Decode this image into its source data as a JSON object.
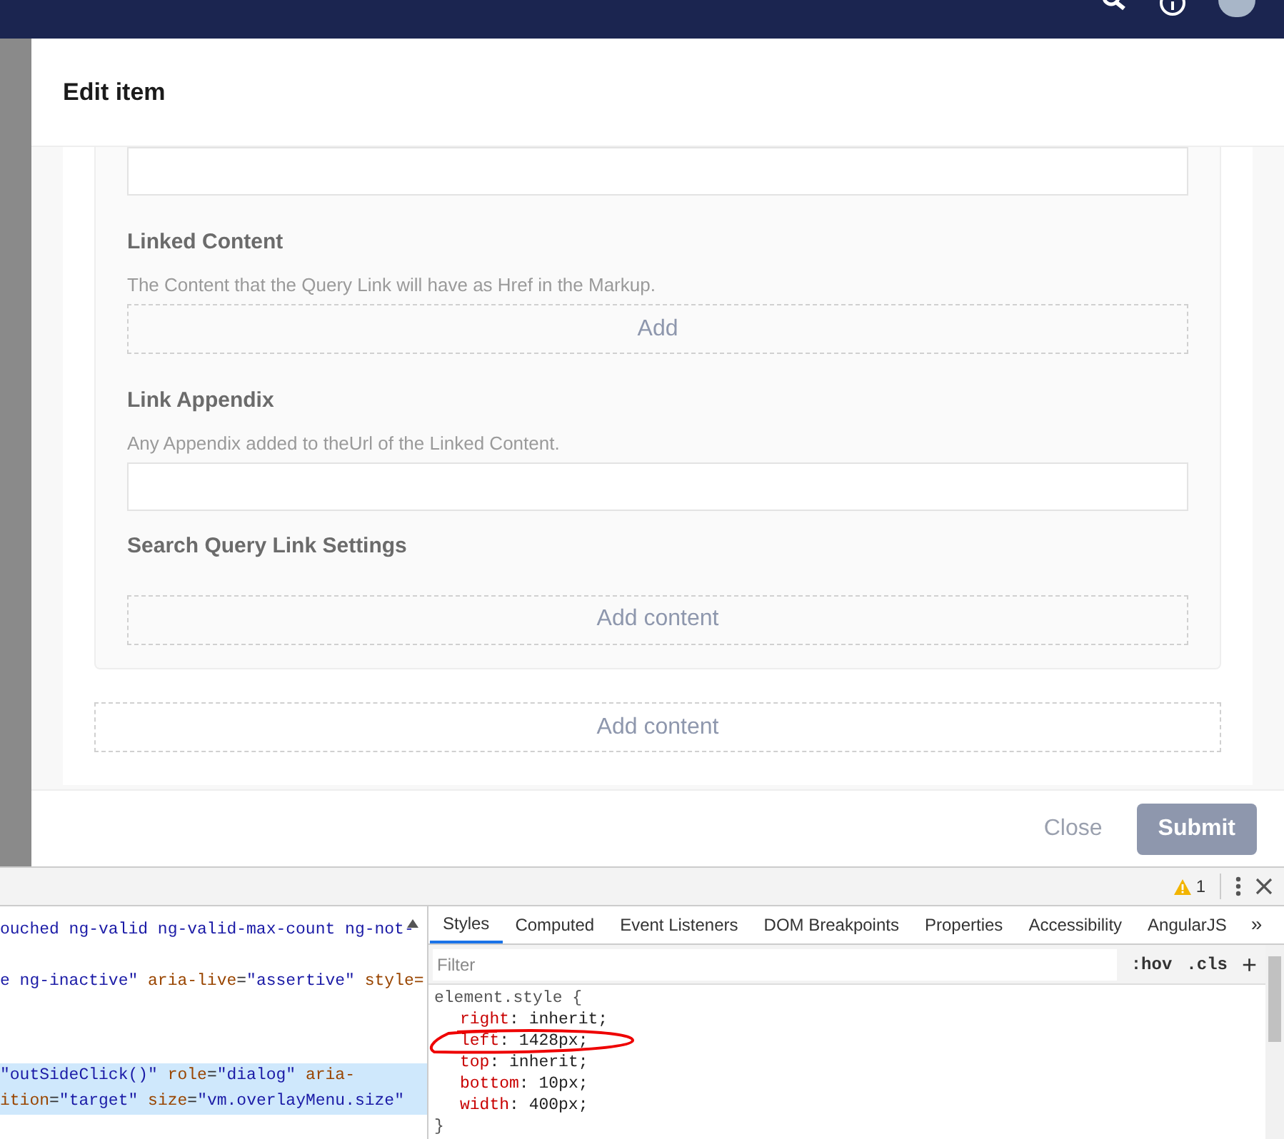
{
  "dialog": {
    "title": "Edit item",
    "fields": [
      {
        "kind": "input"
      },
      {
        "kind": "picker",
        "label": "Linked Content",
        "description": "The Content that the Query Link will have as Href in the Markup.",
        "button": "Add"
      },
      {
        "kind": "input",
        "label": "Link Appendix",
        "description": "Any Appendix added to theUrl of the Linked Content."
      },
      {
        "kind": "group",
        "label": "Search Query Link Settings",
        "button": "Add content"
      }
    ],
    "add_button": "Add content",
    "footer": {
      "close": "Close",
      "submit": "Submit"
    }
  },
  "devtools": {
    "warning_count": "1",
    "more_tabs": "»",
    "elements_lines": [
      {
        "selected": false,
        "segments": [
          {
            "kind": "value",
            "text": "ouched ng-valid ng-valid-max-count ng-not-"
          }
        ]
      },
      {
        "selected": false,
        "segments": [
          {
            "kind": "value",
            "text": "e ng-inactive\""
          },
          {
            "kind": "attr",
            "text": " aria-live"
          },
          {
            "kind": "plain",
            "text": "="
          },
          {
            "kind": "value",
            "text": "\"assertive\""
          },
          {
            "kind": "attr",
            "text": " style="
          }
        ]
      },
      {
        "selected": true,
        "segments": [
          {
            "kind": "value",
            "text": "\"outSideClick()\""
          },
          {
            "kind": "attr",
            "text": " role"
          },
          {
            "kind": "plain",
            "text": "="
          },
          {
            "kind": "value",
            "text": "\"dialog\""
          },
          {
            "kind": "attr",
            "text": " aria-"
          }
        ]
      },
      {
        "selected": true,
        "segments": [
          {
            "kind": "attr",
            "text": "ition"
          },
          {
            "kind": "plain",
            "text": "="
          },
          {
            "kind": "value",
            "text": "\"target\""
          },
          {
            "kind": "attr",
            "text": " size"
          },
          {
            "kind": "plain",
            "text": "="
          },
          {
            "kind": "value",
            "text": "\"vm.overlayMenu.size\""
          }
        ]
      }
    ],
    "tabs": [
      {
        "label": "Styles",
        "selected": true
      },
      {
        "label": "Computed",
        "selected": false
      },
      {
        "label": "Event Listeners",
        "selected": false
      },
      {
        "label": "DOM Breakpoints",
        "selected": false
      },
      {
        "label": "Properties",
        "selected": false
      },
      {
        "label": "Accessibility",
        "selected": false
      },
      {
        "label": "AngularJS",
        "selected": false
      }
    ],
    "filter": {
      "placeholder": "Filter"
    },
    "hov": ":hov",
    "cls": ".cls",
    "add": "+",
    "style_rule": {
      "selector": "element.style {",
      "closing": "}",
      "separator": ":",
      "properties": [
        {
          "name": "right",
          "value": "inherit;"
        },
        {
          "name": "left",
          "value": "1428px;"
        },
        {
          "name": "top",
          "value": "inherit;"
        },
        {
          "name": "bottom",
          "value": "10px;"
        },
        {
          "name": "width",
          "value": "400px;"
        }
      ]
    }
  }
}
